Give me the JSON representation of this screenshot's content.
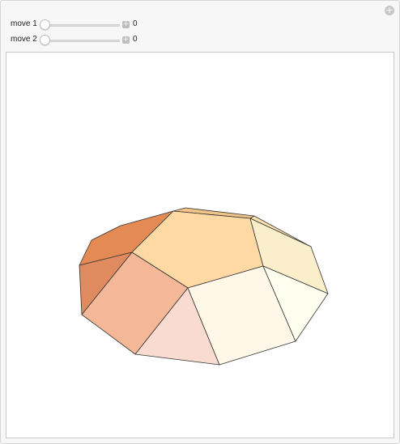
{
  "controls": [
    {
      "label": "move 1",
      "value": "0",
      "slider_fraction": 0
    },
    {
      "label": "move 2",
      "value": "0",
      "slider_fraction": 0
    }
  ],
  "icons": {
    "add": "plus-circle-icon",
    "increment": "plus-square-icon"
  },
  "polyhedron": {
    "edge_color": "#333333",
    "face_colors": {
      "top": "#fed9a3",
      "front_right": "#fff7e8",
      "front_mid": "#fadbd1",
      "front_left": "#f4b898",
      "left_back": "#e38a55",
      "left_side": "#df8a5f",
      "right_back": "#fbeecb",
      "right_side": "#fffff0",
      "back_strip": "#f0c389",
      "back_top_right": "#fae2b0"
    }
  }
}
